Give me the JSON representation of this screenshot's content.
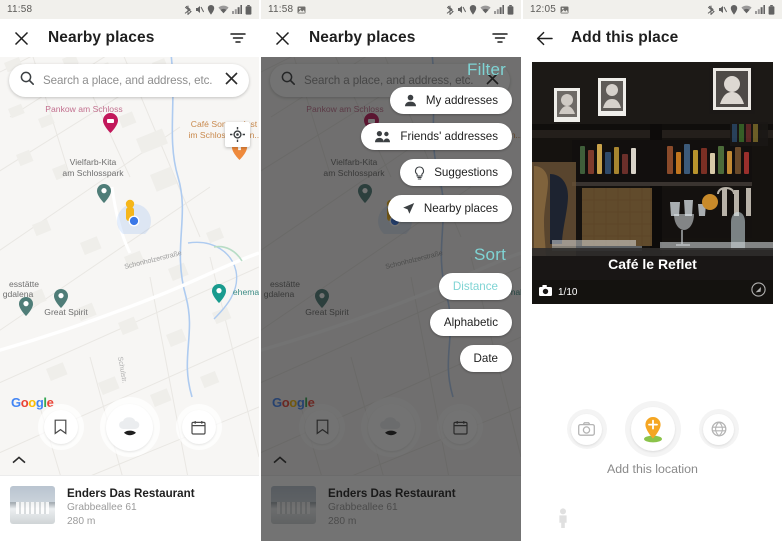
{
  "panels": {
    "left": {
      "status": {
        "time": "11:58",
        "icons": [
          "bluetooth-icon",
          "mute-icon",
          "location-icon",
          "wifi-icon",
          "signal-icon",
          "battery-icon"
        ]
      },
      "appbar": {
        "close_label": "close-icon",
        "title": "Nearby places",
        "filter_label": "filter-icon"
      },
      "search": {
        "placeholder": "Search a place, and address, etc.",
        "value": ""
      },
      "map": {
        "attribution": "Google",
        "labels": [
          {
            "text": "Pankow am Schloss",
            "color": "#c2708f"
          },
          {
            "text": "Café Sommerlust",
            "color": "#c98a4e"
          },
          {
            "text": "im Schlossgarten...",
            "color": "#c98a4e"
          },
          {
            "text": "Vielfarb-Kita",
            "color": "#6f6f6f"
          },
          {
            "text": "am Schlosspark",
            "color": "#6f6f6f"
          },
          {
            "text": "Great Spirit",
            "color": "#6f6f6f"
          },
          {
            "text": "esstätte",
            "color": "#6f6f6f"
          },
          {
            "text": "gdalena",
            "color": "#6f6f6f"
          },
          {
            "text": "ehemal",
            "color": "#3c8c85"
          }
        ],
        "street": "Schonholzerstraße"
      },
      "actions": [
        {
          "name": "bookmark-button",
          "icon": "bookmark-icon"
        },
        {
          "name": "restaurant-button",
          "icon": "chef-hat-icon"
        },
        {
          "name": "calendar-button",
          "icon": "calendar-icon"
        }
      ],
      "result": {
        "title": "Enders Das Restaurant",
        "address": "Grabbeallee 61",
        "distance": "280 m"
      }
    },
    "mid": {
      "status": {
        "time": "11:58",
        "icons": [
          "screenshot-icon",
          "bluetooth-icon",
          "mute-icon",
          "location-icon",
          "wifi-icon",
          "signal-icon",
          "battery-icon"
        ]
      },
      "appbar": {
        "close_label": "close-icon",
        "title": "Nearby places",
        "filter_label": "filter-icon"
      },
      "search": {
        "placeholder": "Search a place, and address, etc.",
        "value": ""
      },
      "menu": {
        "filter_heading": "Filter",
        "filter_items": [
          {
            "label": "My addresses",
            "icon": "person-icon",
            "selected": false
          },
          {
            "label": "Friends' addresses",
            "icon": "people-icon",
            "selected": false
          },
          {
            "label": "Suggestions",
            "icon": "bulb-icon",
            "selected": false
          },
          {
            "label": "Nearby places",
            "icon": "navigation-icon",
            "selected": false
          }
        ],
        "sort_heading": "Sort",
        "sort_items": [
          {
            "label": "Distance",
            "selected": true
          },
          {
            "label": "Alphabetic",
            "selected": false
          },
          {
            "label": "Date",
            "selected": false
          }
        ],
        "accent_color": "#7fd4d4"
      },
      "result": {
        "title": "Enders Das Restaurant",
        "address": "Grabbeallee 61",
        "distance": "280 m"
      }
    },
    "right": {
      "status": {
        "time": "12:05",
        "icons": [
          "screenshot-icon",
          "bluetooth-icon",
          "mute-icon",
          "location-icon",
          "wifi-icon",
          "signal-icon",
          "battery-icon"
        ]
      },
      "appbar": {
        "back_label": "back-arrow-icon",
        "title": "Add this place"
      },
      "photo": {
        "caption": "Café le Reflet",
        "counter": "1/10",
        "camera_icon": "camera-icon",
        "edit_icon": "edit-icon"
      },
      "actions": [
        {
          "name": "add-photo-button",
          "icon": "camera-icon",
          "active": false
        },
        {
          "name": "add-place-button",
          "icon": "pin-plus-icon",
          "active": true
        },
        {
          "name": "globe-button",
          "icon": "globe-icon",
          "active": false
        }
      ],
      "action_label": "Add this location",
      "pegman": "pegman-icon"
    }
  },
  "colors": {
    "accent": "#7fd4d4",
    "pin_orange": "#f0a22e",
    "map_bg": "#f7f6f4",
    "statusbar_bg": "#f1f0ec"
  }
}
